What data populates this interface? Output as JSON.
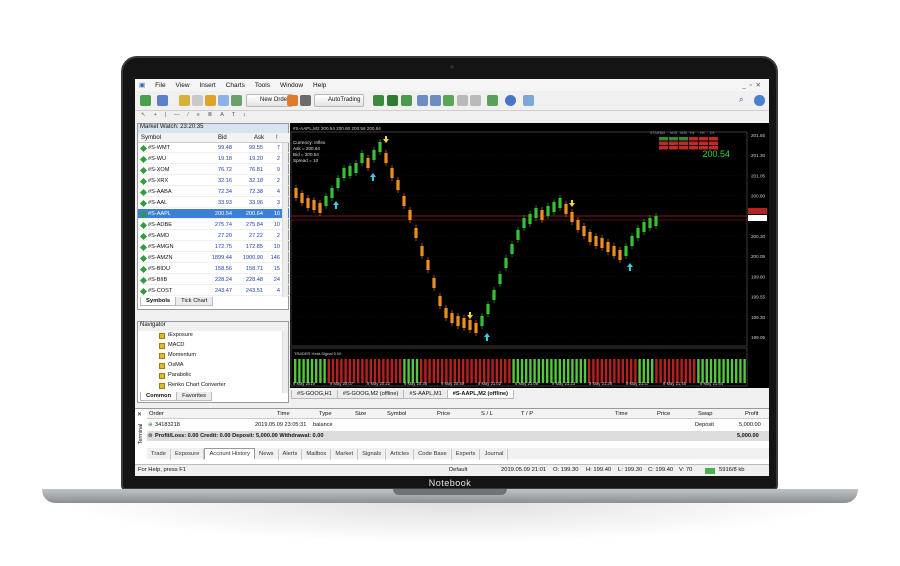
{
  "laptop": {
    "brand": "Notebook"
  },
  "menu": [
    "File",
    "View",
    "Insert",
    "Charts",
    "Tools",
    "Window",
    "Help"
  ],
  "toolbar": {
    "new_order": "New Order",
    "auto_trading": "AutoTrading"
  },
  "market_watch": {
    "title": "Market Watch: 23:20:35",
    "headers": {
      "symbol": "Symbol",
      "bid": "Bid",
      "ask": "Ask",
      "spread": "!"
    },
    "rows": [
      {
        "symbol": "#S-WMT",
        "bid": "99.48",
        "ask": "99.55",
        "spread": "7"
      },
      {
        "symbol": "#S-WU",
        "bid": "19.18",
        "ask": "19.20",
        "spread": "2"
      },
      {
        "symbol": "#S-XOM",
        "bid": "76.72",
        "ask": "76.81",
        "spread": "9"
      },
      {
        "symbol": "#S-XRX",
        "bid": "32.16",
        "ask": "32.18",
        "spread": "2"
      },
      {
        "symbol": "#S-AABA",
        "bid": "72.34",
        "ask": "72.38",
        "spread": "4"
      },
      {
        "symbol": "#S-AAL",
        "bid": "33.93",
        "ask": "33.96",
        "spread": "3"
      },
      {
        "symbol": "#S-AAPL",
        "bid": "200.54",
        "ask": "200.64",
        "spread": "10"
      },
      {
        "symbol": "#S-ADBE",
        "bid": "275.74",
        "ask": "275.84",
        "spread": "10"
      },
      {
        "symbol": "#S-AMD",
        "bid": "27.20",
        "ask": "27.22",
        "spread": "2"
      },
      {
        "symbol": "#S-AMGN",
        "bid": "172.75",
        "ask": "172.85",
        "spread": "10"
      },
      {
        "symbol": "#S-AMZN",
        "bid": "1899.44",
        "ask": "1900.90",
        "spread": "146"
      },
      {
        "symbol": "#S-BIDU",
        "bid": "158.56",
        "ask": "158.71",
        "spread": "15"
      },
      {
        "symbol": "#S-BIIB",
        "bid": "228.24",
        "ask": "228.48",
        "spread": "24"
      },
      {
        "symbol": "#S-COST",
        "bid": "243.47",
        "ask": "243.51",
        "spread": "4"
      }
    ],
    "selected": "#S-AAPL",
    "tabs": [
      "Symbols",
      "Tick Chart"
    ]
  },
  "navigator": {
    "title": "Navigator",
    "items": [
      "iExposure",
      "MACD",
      "Momentum",
      "OsMA",
      "Parabolic",
      "Renko Chart Converter"
    ],
    "tabs": [
      "Common",
      "Favorites"
    ]
  },
  "chart": {
    "title": "#S-AAPL,M2 200.54 200.60 200.56 200.54",
    "info": [
      "Currency: Inflex",
      "Ask = 200.64",
      "Bid = 200.54",
      "Spread = 10"
    ],
    "price_label": "200.54",
    "indicator_label": "TRADER Heat-Signal 5.00",
    "dashboard_header": [
      "START",
      "M5",
      "M15",
      "M30",
      "H1",
      "H4",
      "D1"
    ],
    "y_ticks": [
      "201.55",
      "201.30",
      "201.05",
      "200.80",
      "200.54",
      "200.30",
      "200.05",
      "199.80",
      "199.55",
      "199.30",
      "199.05"
    ],
    "x_ticks": [
      "9 May 2019",
      "9 May 20:07",
      "9 May 20:22",
      "9 May 20:36",
      "9 May 20:49",
      "9 May 21:02",
      "9 May 21:08",
      "9 May 21:23",
      "9 May 21:29",
      "9 May 21:37",
      "9 May 21:45",
      "9 May 21:64"
    ],
    "tabs": [
      "#S-GOOG,H1",
      "#S-GOOG,M2 (offline)",
      "#S-AAPL,M1",
      "#S-AAPL,M2 (offline)"
    ],
    "active_tab": "#S-AAPL,M2 (offline)"
  },
  "terminal": {
    "headers": [
      "Order",
      "Time",
      "Type",
      "Size",
      "Symbol",
      "Price",
      "S / L",
      "T / P",
      "Time",
      "Price",
      "Swap",
      "Profit"
    ],
    "row": {
      "order": "34183218",
      "time": "2019.05.09 23:05:31",
      "type": "balance",
      "swap": "Deposit",
      "profit": "5,000.00"
    },
    "summary": {
      "text": "Profit/Loss: 0.00  Credit: 0.00  Deposit: 5,000.00  Withdrawal: 0.00",
      "profit": "5,000.00"
    },
    "tabs": [
      "Trade",
      "Exposure",
      "Account History",
      "News",
      "Alerts",
      "Mailbox",
      "Market",
      "Signals",
      "Articles",
      "Code Base",
      "Experts",
      "Journal"
    ],
    "active_tab": "Account History",
    "side_label": "Terminal"
  },
  "status": {
    "help": "For Help, press F1",
    "profile": "Default",
    "datetime": "2019.05.09 21:01",
    "open": "O: 199.30",
    "high": "H: 199.40",
    "low": "L: 199.30",
    "close": "C: 199.40",
    "volume": "V: 70",
    "traffic": "5916/8 kb"
  }
}
